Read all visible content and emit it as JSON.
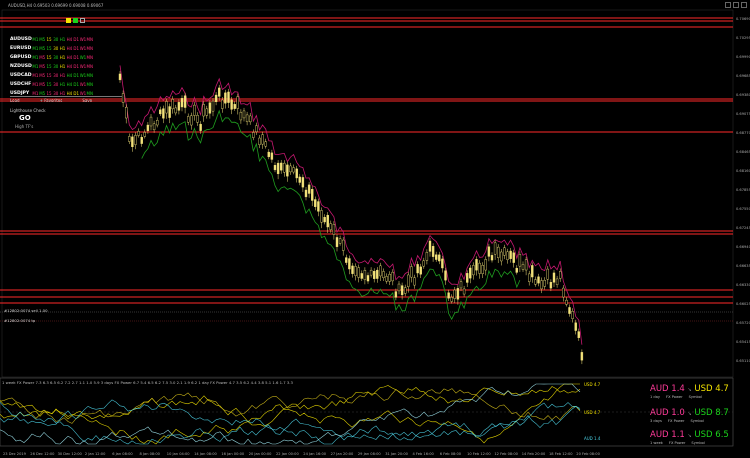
{
  "window": {
    "title": "AUDUSD,H4  0.69503 0.69699 0.69008 0.69067"
  },
  "panel": {
    "rows": [
      {
        "symbol": "AUDUSD",
        "tfs": [
          [
            "M1",
            "g"
          ],
          [
            "M5",
            "g"
          ],
          [
            "15",
            "y"
          ],
          [
            "30",
            "g"
          ],
          [
            "H1",
            "g"
          ],
          [
            "H4",
            "r"
          ],
          [
            "D1",
            "r"
          ],
          [
            "W1",
            "r"
          ],
          [
            "MN",
            "r"
          ]
        ]
      },
      {
        "symbol": "EURUSD",
        "tfs": [
          [
            "M1",
            "g"
          ],
          [
            "M5",
            "g"
          ],
          [
            "15",
            "g"
          ],
          [
            "30",
            "y"
          ],
          [
            "H1",
            "y"
          ],
          [
            "H4",
            "r"
          ],
          [
            "D1",
            "r"
          ],
          [
            "W1",
            "r"
          ],
          [
            "MN",
            "r"
          ]
        ]
      },
      {
        "symbol": "GBPUSD",
        "tfs": [
          [
            "M1",
            "g"
          ],
          [
            "M5",
            "r"
          ],
          [
            "15",
            "y"
          ],
          [
            "30",
            "g"
          ],
          [
            "H1",
            "y"
          ],
          [
            "H4",
            "r"
          ],
          [
            "D1",
            "r"
          ],
          [
            "W1",
            "g"
          ],
          [
            "MN",
            "r"
          ]
        ]
      },
      {
        "symbol": "NZDUSD",
        "tfs": [
          [
            "M1",
            "g"
          ],
          [
            "M5",
            "r"
          ],
          [
            "15",
            "g"
          ],
          [
            "30",
            "g"
          ],
          [
            "H1",
            "y"
          ],
          [
            "H4",
            "r"
          ],
          [
            "D1",
            "r"
          ],
          [
            "W1",
            "r"
          ],
          [
            "MN",
            "r"
          ]
        ]
      },
      {
        "symbol": "USDCAD",
        "tfs": [
          [
            "M1",
            "r"
          ],
          [
            "M5",
            "r"
          ],
          [
            "15",
            "r"
          ],
          [
            "30",
            "r"
          ],
          [
            "H1",
            "r"
          ],
          [
            "H4",
            "g"
          ],
          [
            "D1",
            "g"
          ],
          [
            "W1",
            "g"
          ],
          [
            "MN",
            "g"
          ]
        ]
      },
      {
        "symbol": "USDCHF",
        "tfs": [
          [
            "M1",
            "r"
          ],
          [
            "M5",
            "r"
          ],
          [
            "15",
            "g"
          ],
          [
            "30",
            "r"
          ],
          [
            "H1",
            "g"
          ],
          [
            "H4",
            "g"
          ],
          [
            "D1",
            "g"
          ],
          [
            "W1",
            "r"
          ],
          [
            "MN",
            "g"
          ]
        ]
      },
      {
        "symbol": "USDJPY",
        "tfs": [
          [
            "M1",
            "r"
          ],
          [
            "M5",
            "g"
          ],
          [
            "15",
            "r"
          ],
          [
            "30",
            "r"
          ],
          [
            "H1",
            "r"
          ],
          [
            "H4",
            "y"
          ],
          [
            "D1",
            "y"
          ],
          [
            "W1",
            "r"
          ],
          [
            "MN",
            "g"
          ]
        ]
      }
    ],
    "load_label": "Load",
    "favorites_label": "+ Favorites",
    "save_label": "Save",
    "lighthouse_label": "Lighthouse Check",
    "go_label": "GO",
    "high_label": "High TF's"
  },
  "colors": {
    "background": "#000000",
    "candle": "#f2e27a",
    "upper_band": "#c4186f",
    "lower_band": "#1f9d1f",
    "hline_red": "#ff2a2a",
    "aud_line": "#f5e400",
    "usd_line": "#4bd2e6",
    "aud_tag": "#ff3b9a",
    "usd_tag": "#f5e400"
  },
  "price_axis": {
    "labels": [
      "0.70690",
      "0.70295",
      "0.69990",
      "0.69685",
      "0.69380",
      "0.69075",
      "0.68770",
      "0.68465",
      "0.68160",
      "0.67855",
      "0.67550",
      "0.67245",
      "0.66940",
      "0.66635",
      "0.66330",
      "0.66025",
      "0.65720",
      "0.65415",
      "0.65110"
    ]
  },
  "h_lines": [
    {
      "label": "#12802:0074 sell 1.00"
    },
    {
      "label": "#12802:0074 tp"
    }
  ],
  "time_axis": {
    "labels": [
      "23 Dec 2019",
      "26 Dec 12:00",
      "30 Dec 12:00",
      "2 Jan 12:00",
      "6 Jan 08:00",
      "8 Jan 08:00",
      "10 Jan 04:00",
      "14 Jan 08:00",
      "16 Jan 00:00",
      "20 Jan 00:00",
      "22 Jan 00:00",
      "24 Jan 16:00",
      "27 Jan 20:00",
      "29 Jan 08:00",
      "31 Jan 20:00",
      "4 Feb 16:00",
      "6 Feb 08:00",
      "10 Feb 12:00",
      "12 Feb 08:00",
      "14 Feb 20:00",
      "18 Feb 12:00",
      "20 Feb 08:00"
    ]
  },
  "indicator": {
    "header": "1 week FX Power 7.3 6.3 6.5 6.2 7.2 2.7 1.1 1.0 5.9  3 days FX Power 6.7 5.4 6.5 6.2 7.5 3.0 2.1 1.9 6.2  1 day FX Power 4.7 3.5 6.2 4.4 3.8 5.1 1.6 1.7 3.3",
    "tags": [
      "USD 4.7",
      "USD 4.7",
      "AUD 1.4"
    ],
    "boxes": [
      {
        "aud": "AUD 1.4",
        "usd": "USD 4.7",
        "period": "1 day",
        "label": "FX Power",
        "symbol": "Symbol"
      },
      {
        "aud": "AUD 1.0",
        "usd": "USD 8.7",
        "period": "3 days",
        "label": "FX Power",
        "symbol": "Symbol"
      },
      {
        "aud": "AUD 1.1",
        "usd": "USD 6.5",
        "period": "1 week",
        "label": "FX Power",
        "symbol": "Symbol"
      }
    ]
  }
}
